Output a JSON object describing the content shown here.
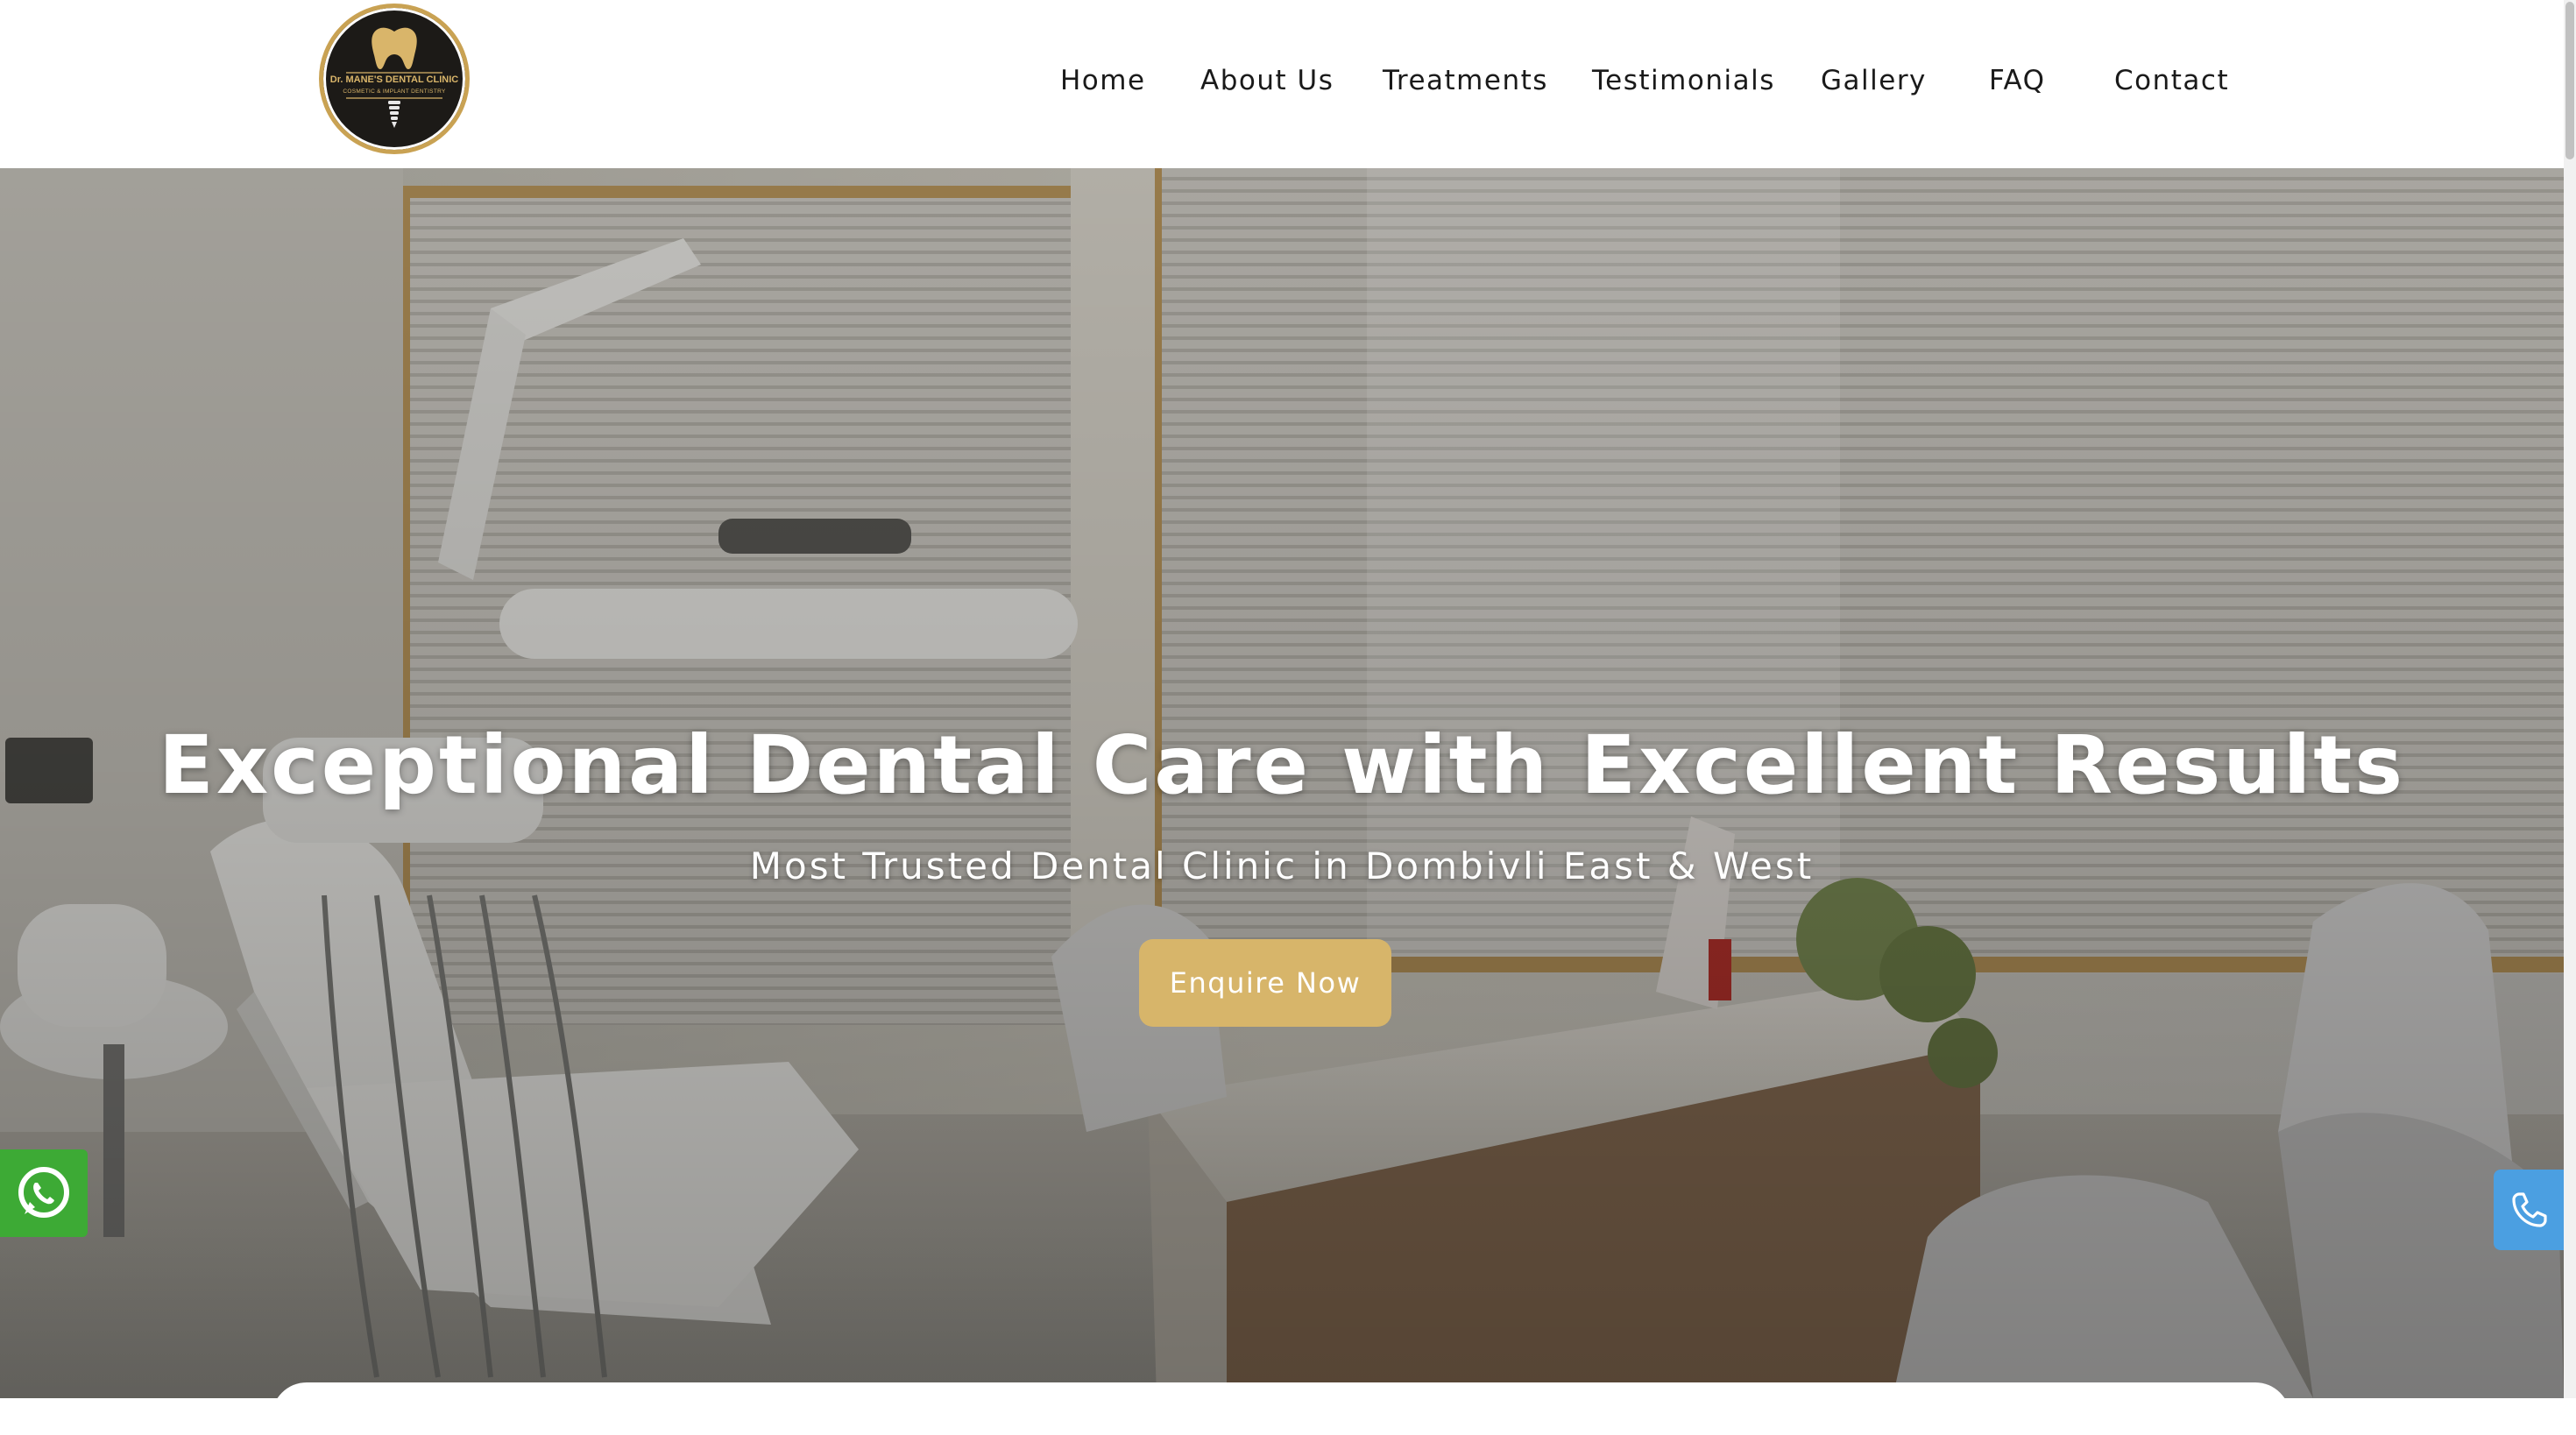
{
  "logo": {
    "name": "Dr. MANE'S DENTAL CLINIC",
    "tagline": "COSMETIC & IMPLANT DENTISTRY",
    "colors": {
      "background": "#1c1a17",
      "gold": "#c9a253"
    }
  },
  "nav": {
    "items": [
      {
        "label": "Home"
      },
      {
        "label": "About Us"
      },
      {
        "label": "Treatments"
      },
      {
        "label": "Testimonials"
      },
      {
        "label": "Gallery"
      },
      {
        "label": "FAQ"
      },
      {
        "label": "Contact"
      }
    ]
  },
  "hero": {
    "title": "Exceptional Dental Care with Excellent Results",
    "subtitle": "Most Trusted Dental Clinic in Dombivli East & West",
    "cta_label": "Enquire Now",
    "background_image": "dental-clinic-interior",
    "accent_color": "#d7b56a"
  },
  "floating": {
    "whatsapp_icon": "whatsapp-icon",
    "phone_icon": "phone-icon",
    "whatsapp_color": "#3daa35",
    "phone_color": "#4b9fe1"
  }
}
